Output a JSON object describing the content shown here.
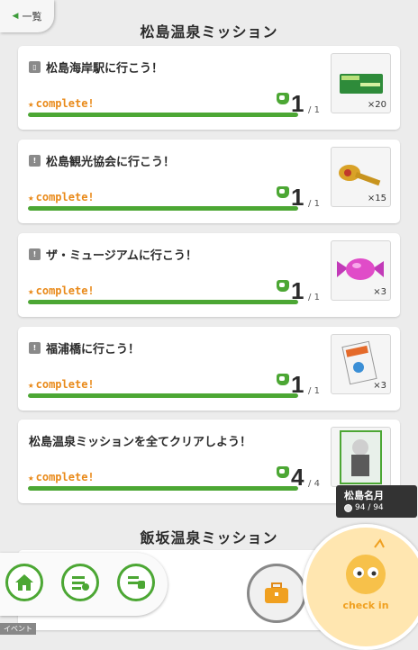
{
  "header": {
    "back_label": "一覧"
  },
  "sections": [
    {
      "title": "松島温泉ミッション"
    },
    {
      "title": "飯坂温泉ミッション"
    }
  ],
  "missions": [
    {
      "title": "松島海岸駅に行こう！",
      "icon": "train-icon",
      "status": "complete!",
      "progress": 1,
      "total": "1",
      "current": "1",
      "reward_qty": "×20",
      "reward_icon": "green-ticket-icon",
      "progress_fraction": 1.0
    },
    {
      "title": "松島観光協会に行こう！",
      "icon": "walk-icon",
      "status": "complete!",
      "progress": 1,
      "total": "1",
      "current": "1",
      "reward_qty": "×15",
      "reward_icon": "gold-key-icon",
      "progress_fraction": 1.0
    },
    {
      "title": "ザ・ミュージアムに行こう！",
      "icon": "walk-icon",
      "status": "complete!",
      "progress": 1,
      "total": "1",
      "current": "1",
      "reward_qty": "×3",
      "reward_icon": "pink-candy-icon",
      "progress_fraction": 1.0
    },
    {
      "title": "福浦橋に行こう！",
      "icon": "walk-icon",
      "status": "complete!",
      "progress": 1,
      "total": "1",
      "current": "1",
      "reward_qty": "×3",
      "reward_icon": "battery-icon",
      "progress_fraction": 1.0
    },
    {
      "title": "松島温泉ミッションを全てクリアしよう！",
      "icon": "",
      "status": "complete!",
      "progress": 4,
      "total": "4",
      "current": "4",
      "reward_qty": "",
      "reward_icon": "character-card-icon",
      "progress_fraction": 1.0
    }
  ],
  "character": {
    "name": "松島名月",
    "points": "94 / 94"
  },
  "nav": {
    "event_label": "イベント",
    "checkin_label": "check in"
  },
  "colors": {
    "accent": "#4ca734",
    "complete": "#e98a1a",
    "checkin_bg": "#ffe6b0"
  }
}
